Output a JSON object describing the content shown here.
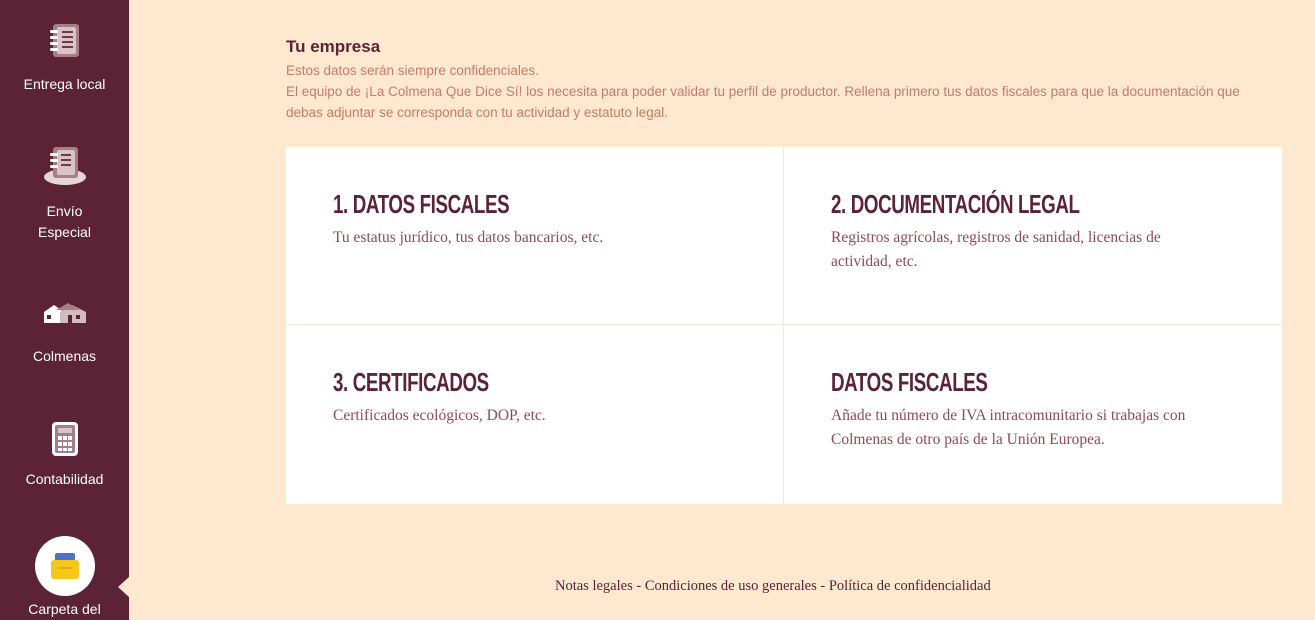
{
  "sidebar": {
    "items": [
      {
        "label": "Entrega local",
        "icon": "notebook-icon"
      },
      {
        "label": "Envío Especial",
        "icon": "notebook-hat-icon"
      },
      {
        "label": "Colmenas",
        "icon": "houses-icon"
      },
      {
        "label": "Contabilidad",
        "icon": "calculator-icon"
      },
      {
        "label": "Carpeta del",
        "icon": "folder-icon"
      }
    ]
  },
  "main": {
    "title": "Tu empresa",
    "subtitle_line1": "Estos datos serán siempre confidenciales.",
    "subtitle_line2": "El equipo de ¡La Colmena Que Dice Sí! los necesita para poder validar tu perfil de productor. Rellena primero tus datos fiscales para que la documentación que",
    "subtitle_line3": "debas adjuntar se corresponda con tu actividad y estatuto legal.",
    "cards": [
      {
        "title": "1. DATOS FISCALES",
        "description": "Tu estatus jurídico, tus datos bancarios, etc."
      },
      {
        "title": "2. DOCUMENTACIÓN LEGAL",
        "description": "Registros agrícolas, registros de sanidad, licencias de actividad, etc."
      },
      {
        "title": "3. CERTIFICADOS",
        "description": "Certificados ecológicos, DOP, etc."
      },
      {
        "title": "DATOS FISCALES",
        "description": "Añade tu número de IVA intracomunitario si trabajas con Colmenas de otro país de la Unión Europea."
      }
    ]
  },
  "footer": {
    "legal": "Notas legales",
    "separator": " - ",
    "terms": "Condiciones de uso generales",
    "privacy": "Política de confidencialidad"
  },
  "colors": {
    "sidebar": "#5b2335",
    "background": "#fee8d0",
    "title": "#5b2335",
    "subtitle": "#c47c6a",
    "card_text": "#8e4a55",
    "folder_accent": "#f6c619"
  }
}
